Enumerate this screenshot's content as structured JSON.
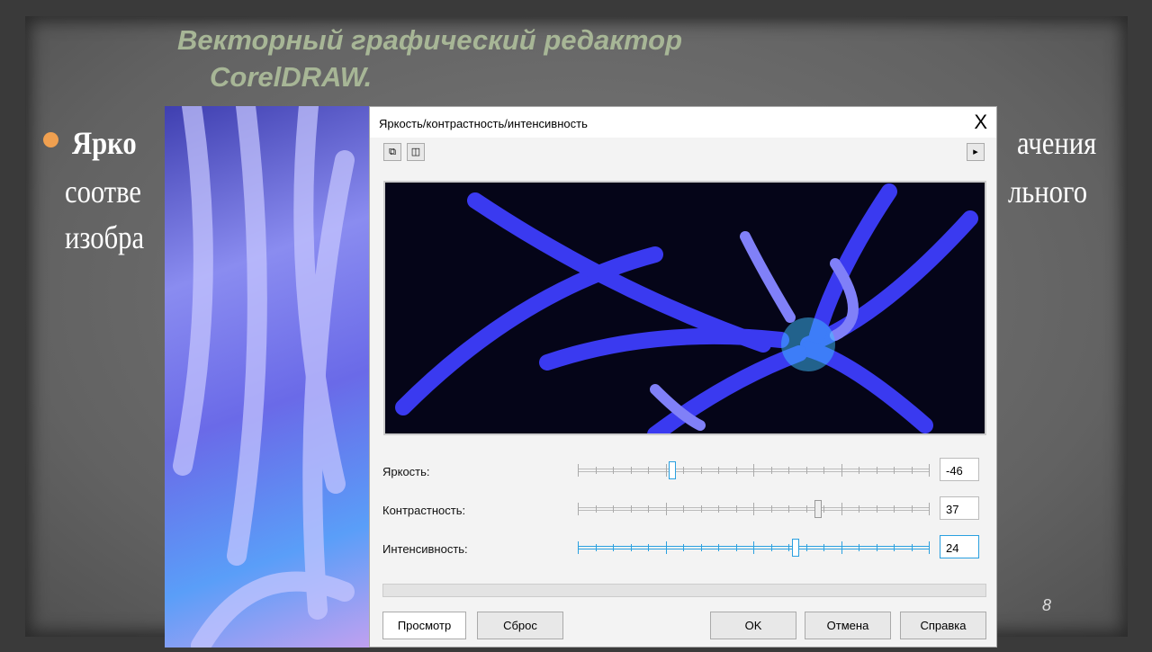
{
  "slide": {
    "title_line1": "Векторный графический редактор",
    "title_line2": "CorelDRAW.",
    "text_line1_start": "Ярко",
    "text_line1_end": "ачения",
    "text_line2_start": "соотве",
    "text_line2_end": "льного",
    "text_line3_start": "изобра",
    "page_number": "8"
  },
  "dialog": {
    "title": "Яркость/контрастность/интенсивность",
    "close_label": "X",
    "sliders": [
      {
        "label": "Яркость:",
        "value": "-46",
        "fraction": 0.27
      },
      {
        "label": "Контрастность:",
        "value": "37",
        "fraction": 0.685
      },
      {
        "label": "Интенсивность:",
        "value": "24",
        "fraction": 0.62
      }
    ],
    "slider_range": [
      -100,
      100
    ],
    "buttons": {
      "preview": "Просмотр",
      "reset": "Сброс",
      "ok": "OK",
      "cancel": "Отмена",
      "help": "Справка"
    },
    "progress": 0
  },
  "colors": {
    "accent": "#2aa0e0",
    "title": "#a7b696"
  }
}
